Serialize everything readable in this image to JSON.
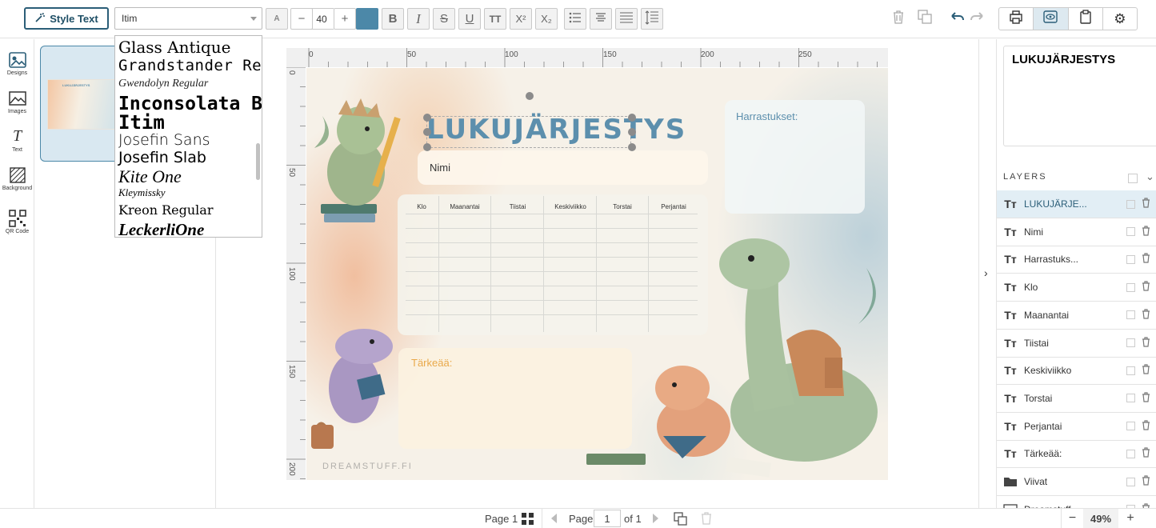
{
  "toolbar": {
    "style_text_label": "Style Text",
    "font_value": "Itim",
    "font_size": "40",
    "text_color": "#4c88a8"
  },
  "left_nav": {
    "items": [
      {
        "label": "Designs",
        "icon": "designs-icon"
      },
      {
        "label": "Images",
        "icon": "image-icon"
      },
      {
        "label": "Text",
        "icon": "text-icon"
      },
      {
        "label": "Background",
        "icon": "background-icon"
      },
      {
        "label": "QR Code",
        "icon": "qr-code-icon"
      }
    ]
  },
  "design_thumb": {
    "title": "LUKUJÄRJESTYS"
  },
  "font_dropdown": {
    "options": [
      "Glass Antique",
      "Grandstander Regular",
      "Gwendolyn Regular",
      "Inconsolata Bold",
      "Itim",
      "Josefin Sans",
      "Josefin Slab",
      "Kite One",
      "Kleymissky",
      "Kreon Regular",
      "LeckerliOne"
    ]
  },
  "rulers": {
    "horizontal": [
      "0",
      "50",
      "100",
      "150",
      "200",
      "250"
    ],
    "vertical": [
      "0",
      "50",
      "100",
      "150",
      "200"
    ]
  },
  "canvas": {
    "title": "LUKUJÄRJESTYS",
    "name_label": "Nimi",
    "hobbies_label": "Harrastukset:",
    "important_label": "Tärkeää:",
    "watermark": "DREAMSTUFF.FI",
    "table_headers": [
      "Klo",
      "Maanantai",
      "Tiistai",
      "Keskiviikko",
      "Torstai",
      "Perjantai"
    ]
  },
  "right_panel": {
    "text_preview": "LUKUJÄRJESTYS",
    "layers_heading": "LAYERS",
    "layers": [
      {
        "label": "LUKUJÄRJE...",
        "kind": "text"
      },
      {
        "label": "Nimi",
        "kind": "text"
      },
      {
        "label": "Harrastuks...",
        "kind": "text"
      },
      {
        "label": "Klo",
        "kind": "text"
      },
      {
        "label": "Maanantai",
        "kind": "text"
      },
      {
        "label": "Tiistai",
        "kind": "text"
      },
      {
        "label": "Keskiviikko",
        "kind": "text"
      },
      {
        "label": "Torstai",
        "kind": "text"
      },
      {
        "label": "Perjantai",
        "kind": "text"
      },
      {
        "label": "Tärkeää:",
        "kind": "text"
      },
      {
        "label": "Viivat",
        "kind": "folder"
      },
      {
        "label": "Dreamstuff...",
        "kind": "image"
      }
    ]
  },
  "bottom_bar": {
    "page_label_left": "Page 1",
    "page_word": "Page",
    "page_number": "1",
    "of_total": "of 1",
    "zoom": "49%"
  }
}
